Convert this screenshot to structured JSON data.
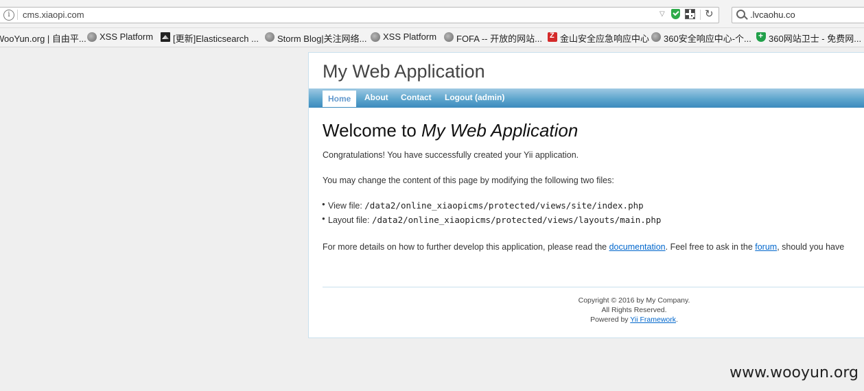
{
  "browser": {
    "url": "cms.xiaopi.com",
    "search_value": ".lvcaohu.co",
    "bookmarks": [
      {
        "label": "WooYun.org | 自由平...",
        "icon": "none"
      },
      {
        "label": "XSS Platform",
        "icon": "globe-icon"
      },
      {
        "label": "[更新]Elasticsearch ...",
        "icon": "dark-bookmark-icon"
      },
      {
        "label": "Storm Blog|关注网络...",
        "icon": "globe-icon"
      },
      {
        "label": "XSS Platform",
        "icon": "globe-icon"
      },
      {
        "label": "FOFA -- 开放的网站...",
        "icon": "globe-icon"
      },
      {
        "label": "金山安全应急响应中心",
        "icon": "red-bookmark-icon"
      },
      {
        "label": "360安全响应中心-个...",
        "icon": "globe-icon"
      },
      {
        "label": "360网站卫士 - 免费网...",
        "icon": "green-shield-icon"
      }
    ]
  },
  "app": {
    "title": "My Web Application",
    "menu": [
      "Home",
      "About",
      "Contact",
      "Logout (admin)"
    ],
    "welcome_prefix": "Welcome to ",
    "welcome_name": "My Web Application",
    "congrats": "Congratulations! You have successfully created your Yii application.",
    "change_text": "You may change the content of this page by modifying the following two files:",
    "files": [
      {
        "label": "View file: ",
        "path": "/data2/online_xiaopicms/protected/views/site/index.php"
      },
      {
        "label": "Layout file: ",
        "path": "/data2/online_xiaopicms/protected/views/layouts/main.php"
      }
    ],
    "details_before": "For more details on how to further develop this application, please read the ",
    "details_link1": "documentation",
    "details_middle": ". Feel free to ask in the ",
    "details_link2": "forum",
    "details_after": ", should you have",
    "footer_line1": "Copyright © 2016 by My Company.",
    "footer_line2": "All Rights Reserved.",
    "footer_powered": "Powered by ",
    "footer_link": "Yii Framework",
    "footer_end": "."
  },
  "watermark": "www.wooyun.org"
}
